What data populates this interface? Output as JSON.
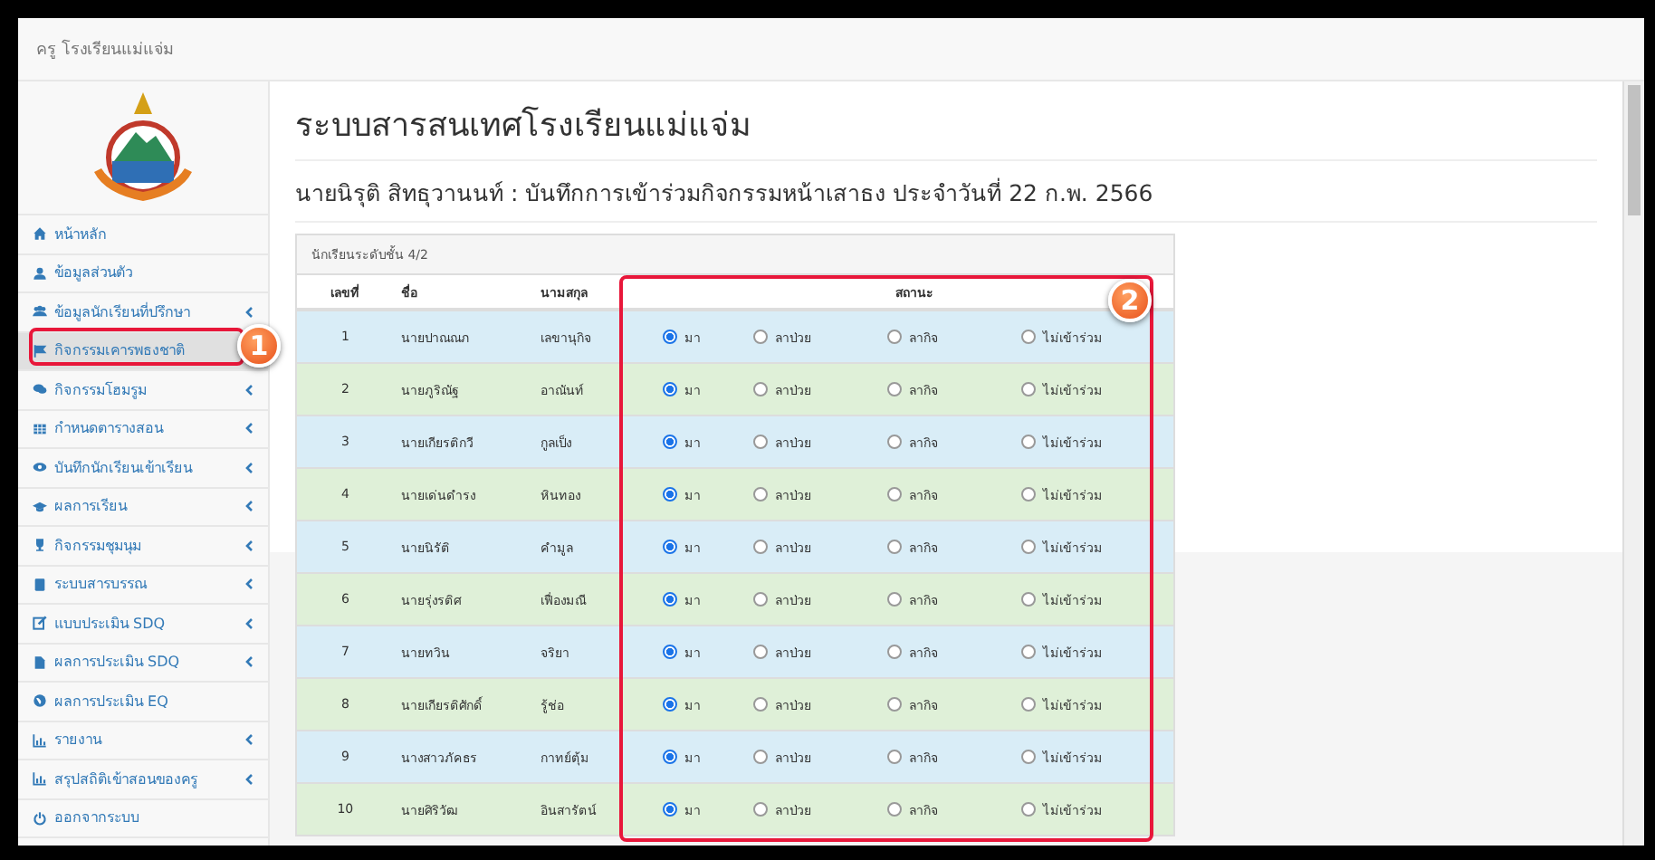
{
  "topbar": {
    "title": "ครู โรงเรียนแม่แจ่ม"
  },
  "sidebar": {
    "items": [
      {
        "label": "หน้าหลัก",
        "submenu": false,
        "selected": false
      },
      {
        "label": "ข้อมูลส่วนตัว",
        "submenu": false,
        "selected": false
      },
      {
        "label": "ข้อมูลนักเรียนที่ปรึกษา",
        "submenu": true,
        "selected": false
      },
      {
        "label": "กิจกรรมเคารพธงชาติ",
        "submenu": false,
        "selected": true
      },
      {
        "label": "กิจกรรมโฮมรูม",
        "submenu": true,
        "selected": false
      },
      {
        "label": "กำหนดตารางสอน",
        "submenu": true,
        "selected": false
      },
      {
        "label": "บันทึกนักเรียนเข้าเรียน",
        "submenu": true,
        "selected": false
      },
      {
        "label": "ผลการเรียน",
        "submenu": true,
        "selected": false
      },
      {
        "label": "กิจกรรมชุมนุม",
        "submenu": true,
        "selected": false
      },
      {
        "label": "ระบบสารบรรณ",
        "submenu": true,
        "selected": false
      },
      {
        "label": "แบบประเมิน SDQ",
        "submenu": true,
        "selected": false
      },
      {
        "label": "ผลการประเมิน SDQ",
        "submenu": true,
        "selected": false
      },
      {
        "label": "ผลการประเมิน EQ",
        "submenu": false,
        "selected": false
      },
      {
        "label": "รายงาน",
        "submenu": true,
        "selected": false
      },
      {
        "label": "สรุปสถิติเข้าสอนของครู",
        "submenu": true,
        "selected": false
      },
      {
        "label": "ออกจากระบบ",
        "submenu": false,
        "selected": false
      }
    ]
  },
  "page_title": "ระบบสารสนเทศโรงเรียนแม่แจ่ม",
  "subtitle": "นายนิรุติ สิทธุวานนท์ : บันทึกการเข้าร่วมกิจกรรมหน้าเสาธง ประจำวันที่ 22 ก.พ. 2566",
  "panel": {
    "heading": "นักเรียนระดับชั้น 4/2",
    "columns": [
      "เลขที่",
      "ชื่อ",
      "นามสกุล",
      "สถานะ"
    ],
    "rows": [
      {
        "no": "1",
        "first_name": "นายปาณณภ",
        "last_name": "เลขานุกิจ",
        "options": [
          {
            "label": "มา",
            "selected": true
          },
          {
            "label": "ลาป่วย",
            "selected": false
          },
          {
            "label": "ลากิจ",
            "selected": false
          },
          {
            "label": "ไม่เข้าร่วม",
            "selected": false
          }
        ]
      },
      {
        "no": "2",
        "first_name": "นายภูริณัฐ",
        "last_name": "อาณันท์",
        "options": [
          {
            "label": "มา",
            "selected": true
          },
          {
            "label": "ลาป่วย",
            "selected": false
          },
          {
            "label": "ลากิจ",
            "selected": false
          },
          {
            "label": "ไม่เข้าร่วม",
            "selected": false
          }
        ]
      },
      {
        "no": "3",
        "first_name": "นายเกียรติกวี",
        "last_name": "กูลเป็ง",
        "options": [
          {
            "label": "มา",
            "selected": true
          },
          {
            "label": "ลาป่วย",
            "selected": false
          },
          {
            "label": "ลากิจ",
            "selected": false
          },
          {
            "label": "ไม่เข้าร่วม",
            "selected": false
          }
        ]
      },
      {
        "no": "4",
        "first_name": "นายเด่นดำรง",
        "last_name": "หินทอง",
        "options": [
          {
            "label": "มา",
            "selected": true
          },
          {
            "label": "ลาป่วย",
            "selected": false
          },
          {
            "label": "ลากิจ",
            "selected": false
          },
          {
            "label": "ไม่เข้าร่วม",
            "selected": false
          }
        ]
      },
      {
        "no": "5",
        "first_name": "นายนิรัติ",
        "last_name": "คำมูล",
        "options": [
          {
            "label": "มา",
            "selected": true
          },
          {
            "label": "ลาป่วย",
            "selected": false
          },
          {
            "label": "ลากิจ",
            "selected": false
          },
          {
            "label": "ไม่เข้าร่วม",
            "selected": false
          }
        ]
      },
      {
        "no": "6",
        "first_name": "นายรุ่งรติศ",
        "last_name": "เฟื่องมณี",
        "options": [
          {
            "label": "มา",
            "selected": true
          },
          {
            "label": "ลาป่วย",
            "selected": false
          },
          {
            "label": "ลากิจ",
            "selected": false
          },
          {
            "label": "ไม่เข้าร่วม",
            "selected": false
          }
        ]
      },
      {
        "no": "7",
        "first_name": "นายทวิน",
        "last_name": "จริยา",
        "options": [
          {
            "label": "มา",
            "selected": true
          },
          {
            "label": "ลาป่วย",
            "selected": false
          },
          {
            "label": "ลากิจ",
            "selected": false
          },
          {
            "label": "ไม่เข้าร่วม",
            "selected": false
          }
        ]
      },
      {
        "no": "8",
        "first_name": "นายเกียรติศักดิ์",
        "last_name": "รู้ช่อ",
        "options": [
          {
            "label": "มา",
            "selected": true
          },
          {
            "label": "ลาป่วย",
            "selected": false
          },
          {
            "label": "ลากิจ",
            "selected": false
          },
          {
            "label": "ไม่เข้าร่วม",
            "selected": false
          }
        ]
      },
      {
        "no": "9",
        "first_name": "นางสาวภัคธร",
        "last_name": "กาทย์ตุ้ม",
        "options": [
          {
            "label": "มา",
            "selected": true
          },
          {
            "label": "ลาป่วย",
            "selected": false
          },
          {
            "label": "ลากิจ",
            "selected": false
          },
          {
            "label": "ไม่เข้าร่วม",
            "selected": false
          }
        ]
      },
      {
        "no": "10",
        "first_name": "นายศิริวัฒ",
        "last_name": "อินสารัตน์",
        "options": [
          {
            "label": "มา",
            "selected": true
          },
          {
            "label": "ลาป่วย",
            "selected": false
          },
          {
            "label": "ลากิจ",
            "selected": false
          },
          {
            "label": "ไม่เข้าร่วม",
            "selected": false
          }
        ]
      }
    ]
  },
  "annotations": [
    {
      "label": "1"
    },
    {
      "label": "2"
    }
  ]
}
